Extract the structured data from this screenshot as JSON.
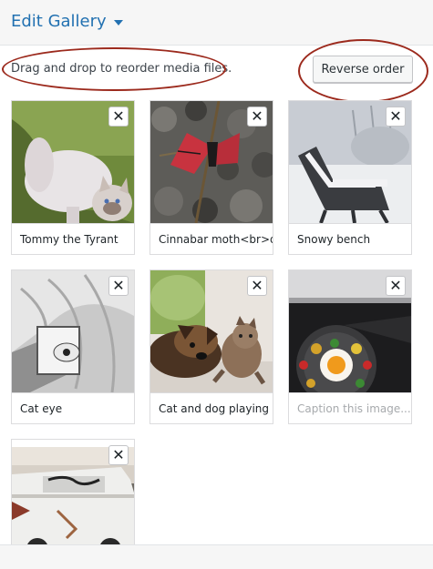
{
  "header": {
    "title": "Edit Gallery",
    "caret_icon": "chevron-down-icon"
  },
  "toolbar": {
    "hint": "Drag and drop to reorder media files.",
    "reverse_label": "Reverse order"
  },
  "gallery": {
    "remove_glyph": "✕",
    "items": [
      {
        "caption": "Tommy the Tyrant"
      },
      {
        "caption": "Cinnabar moth<br>d"
      },
      {
        "caption": "Snowy bench"
      },
      {
        "caption": "Cat eye"
      },
      {
        "caption": "Cat and dog playing t"
      },
      {
        "caption_placeholder": "Caption this image..."
      },
      {
        "caption": ""
      }
    ]
  },
  "colors": {
    "accent": "#2271b1",
    "annotation": "#9c2a1d"
  }
}
